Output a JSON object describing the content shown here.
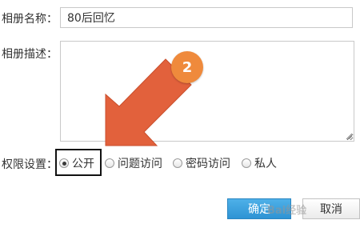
{
  "form": {
    "name_label": "相册名称：",
    "name_value": "80后回忆",
    "desc_label": "相册描述：",
    "desc_value": "",
    "permission_label": "权限设置："
  },
  "permissions": [
    {
      "label": "公开",
      "checked": true
    },
    {
      "label": "问题访问",
      "checked": false
    },
    {
      "label": "密码访问",
      "checked": false
    },
    {
      "label": "私人",
      "checked": false
    }
  ],
  "buttons": {
    "confirm": "确定",
    "cancel": "取消"
  },
  "annotation": {
    "step_number": "2",
    "arrow_color": "#e2613c",
    "badge_color": "#ef8a3c"
  },
  "colors": {
    "confirm_button": "#3aa0de",
    "highlight_border": "#111111"
  },
  "watermark": "Bai经验"
}
